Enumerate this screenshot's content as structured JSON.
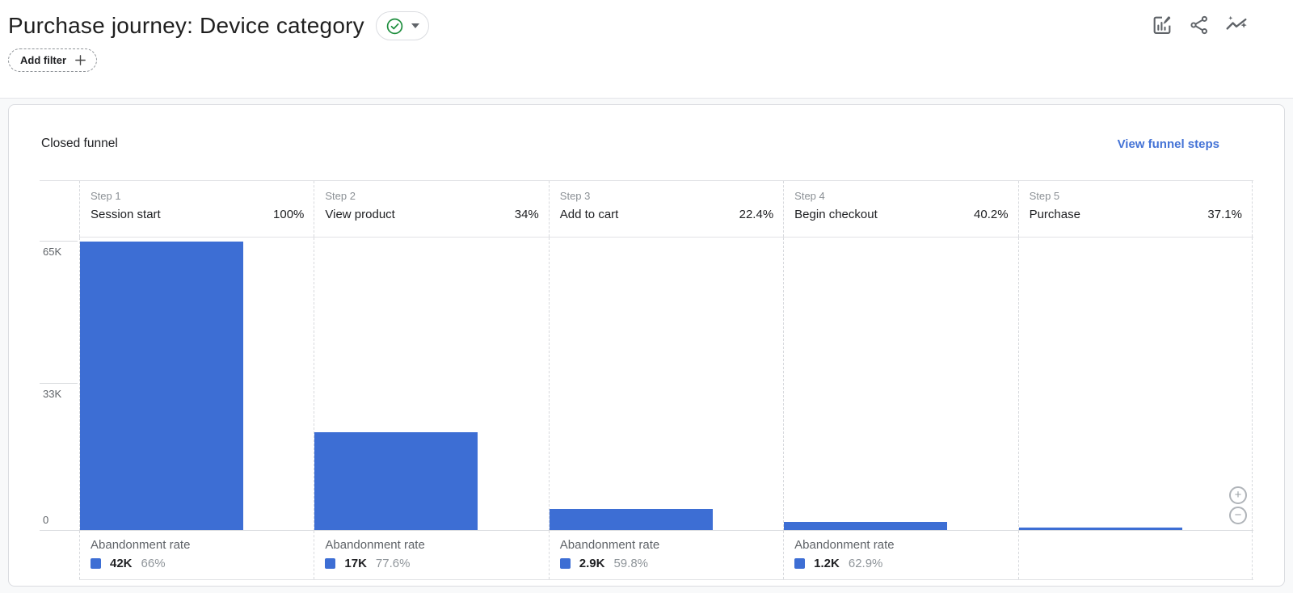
{
  "header": {
    "title": "Purchase journey: Device category",
    "add_filter_label": "Add filter"
  },
  "card": {
    "heading": "Closed funnel",
    "view_funnel_steps_label": "View funnel steps"
  },
  "chart_data": {
    "type": "bar",
    "title": "Closed funnel",
    "bar_color": "#3D6ED4",
    "abandonment_label": "Abandonment rate",
    "y_axis": {
      "max_k": 65,
      "ticks": [
        {
          "label": "65K",
          "value_k": 65
        },
        {
          "label": "33K",
          "value_k": 33
        },
        {
          "label": "0",
          "value_k": 0
        }
      ]
    },
    "steps": [
      {
        "step_label": "Step 1",
        "event": "Session start",
        "completion_rate": "100%",
        "users_k": 65,
        "abandonment": {
          "count": "42K",
          "rate": "66%"
        }
      },
      {
        "step_label": "Step 2",
        "event": "View product",
        "completion_rate": "34%",
        "users_k": 22.1,
        "abandonment": {
          "count": "17K",
          "rate": "77.6%"
        }
      },
      {
        "step_label": "Step 3",
        "event": "Add to cart",
        "completion_rate": "22.4%",
        "users_k": 4.9,
        "abandonment": {
          "count": "2.9K",
          "rate": "59.8%"
        }
      },
      {
        "step_label": "Step 4",
        "event": "Begin checkout",
        "completion_rate": "40.2%",
        "users_k": 2.0,
        "abandonment": {
          "count": "1.2K",
          "rate": "62.9%"
        }
      },
      {
        "step_label": "Step 5",
        "event": "Purchase",
        "completion_rate": "37.1%",
        "users_k": 0.75,
        "abandonment": null
      }
    ]
  },
  "zoom_controls": {
    "zoom_in": "+",
    "zoom_out": "−"
  }
}
